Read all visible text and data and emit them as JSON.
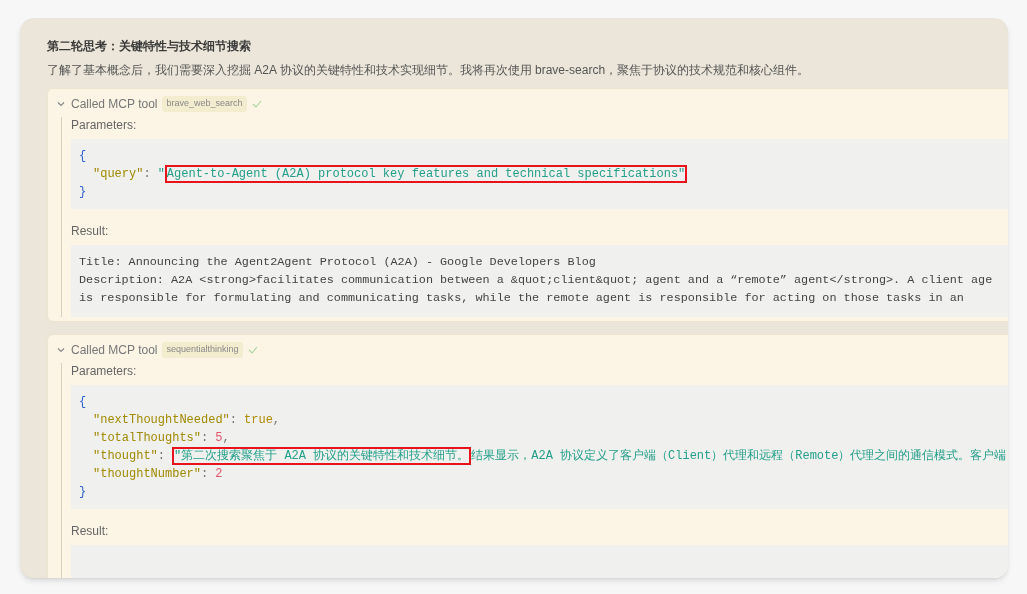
{
  "heading": "第二轮思考：关键特性与技术细节搜索",
  "intro": "了解了基本概念后，我们需要深入挖掘 A2A 协议的关键特性和技术实现细节。我将再次使用 brave-search，聚焦于协议的技术规范和核心组件。",
  "tool_calls": [
    {
      "expanded": true,
      "label": "Called MCP tool",
      "tool": "brave_web_search",
      "done": true,
      "parameters_label": "Parameters:",
      "open_brace": "{",
      "close_brace": "}",
      "parameters": [
        {
          "key": "\"query\"",
          "separator": ":",
          "kind": "string",
          "segments": [
            {
              "text": "\"",
              "highlighted": false
            },
            {
              "text": "Agent-to-Agent (A2A) protocol key features and technical specifications\"",
              "highlighted": true
            }
          ]
        }
      ],
      "result_label": "Result:",
      "result_lines": [
        "Title: Announcing the Agent2Agent Protocol (A2A) - Google Developers Blog",
        "Description: A2A <strong>facilitates communication between a &quot;client&quot; agent and a “remote” agent</strong>. A client age",
        "is responsible for formulating and communicating tasks, while the remote agent is responsible for acting on those tasks in an"
      ]
    },
    {
      "expanded": true,
      "label": "Called MCP tool",
      "tool": "sequentialthinking",
      "done": true,
      "parameters_label": "Parameters:",
      "open_brace": "{",
      "close_brace": "}",
      "parameters": [
        {
          "key": "\"nextThoughtNeeded\"",
          "separator": ":",
          "kind": "boolean",
          "segments": [
            {
              "text": "true",
              "highlighted": false
            }
          ],
          "trailing": ","
        },
        {
          "key": "\"totalThoughts\"",
          "separator": ":",
          "kind": "number",
          "segments": [
            {
              "text": "5",
              "highlighted": false
            }
          ],
          "trailing": ","
        },
        {
          "key": "\"thought\"",
          "separator": ":",
          "kind": "string",
          "segments": [
            {
              "text": "\"第二次搜索聚焦于 A2A 协议的关键特性和技术细节。",
              "highlighted": true
            },
            {
              "text": "结果显示，A2A 协议定义了客户端（Client）代理和远程（Remote）代理之间的通信模式。客户端",
              "highlighted": false
            }
          ]
        },
        {
          "key": "\"thoughtNumber\"",
          "separator": ":",
          "kind": "number",
          "segments": [
            {
              "text": "2",
              "highlighted": false
            }
          ]
        }
      ],
      "result_label": "Result:"
    }
  ]
}
